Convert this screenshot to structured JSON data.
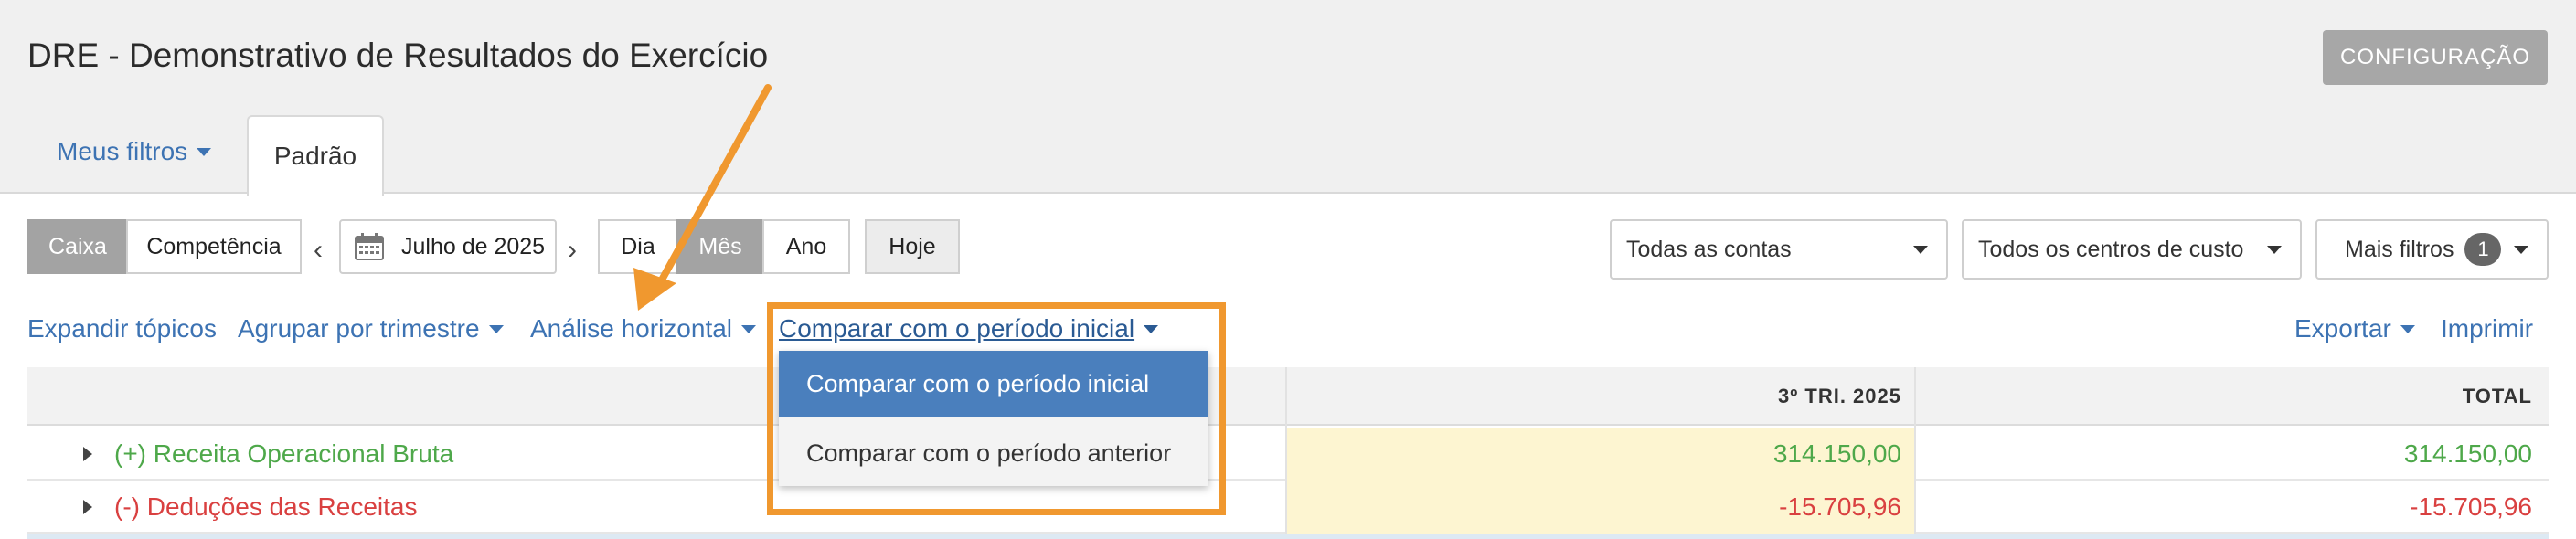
{
  "header": {
    "title": "DRE - Demonstrativo de Resultados do Exercício",
    "config_button": "CONFIGURAÇÃO"
  },
  "tabs": {
    "my_filters": "Meus filtros",
    "default": "Padrão"
  },
  "toolbar": {
    "regime": [
      "Caixa",
      "Competência"
    ],
    "regime_selected": "Caixa",
    "prev_icon": "chevron-left-icon",
    "calendar_icon": "calendar-icon",
    "period": "Julho de 2025",
    "next_icon": "chevron-right-icon",
    "granularity": [
      "Dia",
      "Mês",
      "Ano"
    ],
    "granularity_selected": "Mês",
    "today": "Hoje",
    "accounts": "Todas as contas",
    "cost_centers": "Todos os centros de custo",
    "more_filters": "Mais filtros",
    "more_filters_count": "1"
  },
  "actions": {
    "expand": "Expandir tópicos",
    "group": "Agrupar por trimestre",
    "horizontal": "Análise horizontal",
    "compare": "Comparar com o período inicial",
    "export": "Exportar",
    "print": "Imprimir"
  },
  "compare_menu": {
    "options": [
      "Comparar com o período inicial",
      "Comparar com o período anterior"
    ],
    "selected": "Comparar com o período inicial"
  },
  "table": {
    "columns": [
      "",
      "3º TRI. 2025",
      "TOTAL"
    ],
    "rows": [
      {
        "label": "(+) Receita Operacional Bruta",
        "q3": "314.150,00",
        "total": "314.150,00",
        "color": "#4ea84a"
      },
      {
        "label": "(-) Deduções das Receitas",
        "q3": "-15.705,96",
        "total": "-15.705,96",
        "color": "#d94040"
      }
    ]
  },
  "colors": {
    "link": "#3d73b3",
    "highlight": "#f0982f",
    "selected_option": "#4a7fbd"
  }
}
